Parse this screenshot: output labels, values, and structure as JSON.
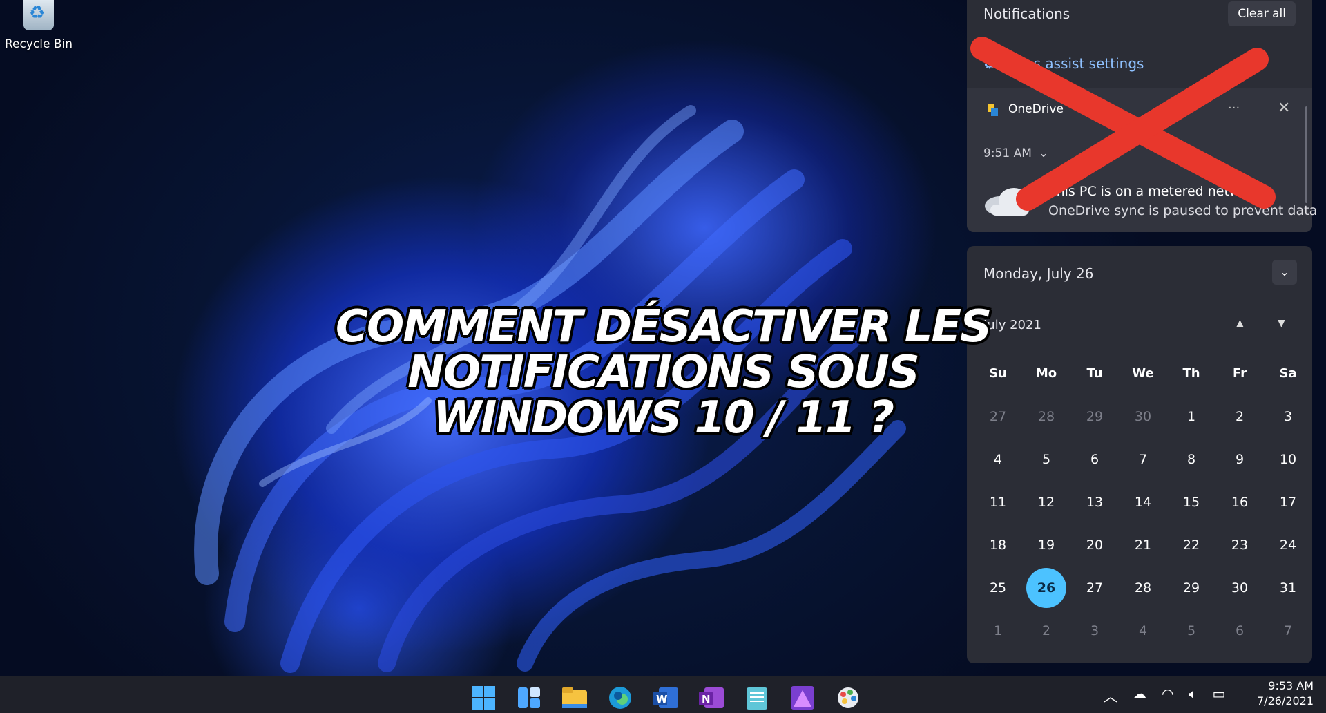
{
  "desktop": {
    "icons": [
      {
        "label": "Recycle Bin",
        "icon": "recycle-bin-icon"
      }
    ]
  },
  "headline": {
    "line1": "COMMENT DÉSACTIVER LES NOTIFICATIONS SOUS",
    "line2": "WINDOWS 10 / 11 ?"
  },
  "notifications": {
    "title": "Notifications",
    "clear_all_label": "Clear all",
    "focus_assist_link": "Focus assist settings",
    "toast": {
      "app_name": "OneDrive",
      "more_label": "···",
      "close_label": "✕",
      "time": "9:51 AM",
      "line1": "This PC is on a metered network",
      "line2": "OneDrive sync is paused to prevent data"
    },
    "overlay_mark": "red-x-cross"
  },
  "calendar": {
    "date_header": "Monday, July 26",
    "month_label": "July 2021",
    "weekdays": [
      "Su",
      "Mo",
      "Tu",
      "We",
      "Th",
      "Fr",
      "Sa"
    ],
    "weeks": [
      [
        "27",
        "28",
        "29",
        "30",
        "1",
        "2",
        "3"
      ],
      [
        "4",
        "5",
        "6",
        "7",
        "8",
        "9",
        "10"
      ],
      [
        "11",
        "12",
        "13",
        "14",
        "15",
        "16",
        "17"
      ],
      [
        "18",
        "19",
        "20",
        "21",
        "22",
        "23",
        "24"
      ],
      [
        "25",
        "26",
        "27",
        "28",
        "29",
        "30",
        "31"
      ],
      [
        "1",
        "2",
        "3",
        "4",
        "5",
        "6",
        "7"
      ]
    ],
    "today": "26"
  },
  "taskbar": {
    "apps": [
      "start-icon",
      "widgets-icon",
      "file-explorer-icon",
      "edge-icon",
      "word-icon",
      "onenote-icon",
      "notepad-icon",
      "affinity-icon",
      "paint-icon"
    ],
    "tray": [
      "chevron-up-icon",
      "onedrive-icon",
      "wifi-icon",
      "volume-icon",
      "battery-icon"
    ],
    "time": "9:53 AM",
    "date": "7/26/2021"
  },
  "colors": {
    "accent": "#4cc2ff",
    "panel_bg": "#2b2d36",
    "red_x": "#e8372c"
  }
}
